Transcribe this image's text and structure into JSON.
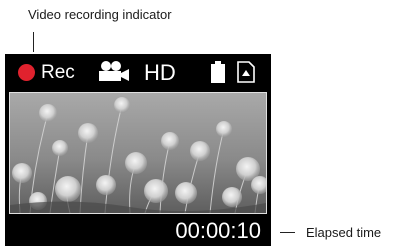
{
  "callouts": {
    "recording_indicator": "Video recording indicator",
    "elapsed_time": "Elapsed time"
  },
  "camera_screen": {
    "status_bar": {
      "recording_label": "Rec",
      "quality_label": "HD",
      "recording_dot_color": "#e0222e",
      "video_mode_icon": "video-camera-icon",
      "battery_icon": "battery-icon",
      "storage_icon": "memory-card-icon"
    },
    "preview_subject": "dandelion-seed-heads-photo",
    "elapsed_time": "00:00:10"
  }
}
